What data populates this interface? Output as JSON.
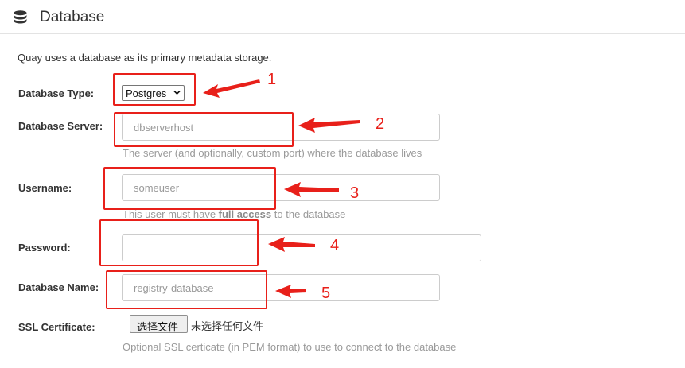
{
  "header": {
    "title": "Database",
    "icon": "database-icon"
  },
  "intro": "Quay uses a database as its primary metadata storage.",
  "fields": {
    "type": {
      "label": "Database Type:",
      "value": "Postgres"
    },
    "server": {
      "label": "Database Server:",
      "placeholder": "dbserverhost",
      "help": "The server (and optionally, custom port) where the database lives"
    },
    "username": {
      "label": "Username:",
      "placeholder": "someuser",
      "help_prefix": "This user must have ",
      "help_bold": "full access",
      "help_suffix": " to the database"
    },
    "password": {
      "label": "Password:",
      "placeholder": ""
    },
    "name": {
      "label": "Database Name:",
      "placeholder": "registry-database"
    },
    "ssl": {
      "label": "SSL Certificate:",
      "button": "选择文件",
      "status": "未选择任何文件",
      "help": "Optional SSL certicate (in PEM format) to use to connect to the database"
    }
  },
  "annotations": [
    "1",
    "2",
    "3",
    "4",
    "5"
  ],
  "colors": {
    "annotation": "#e8201a",
    "placeholder": "#999999",
    "help": "#9a9a9a"
  }
}
